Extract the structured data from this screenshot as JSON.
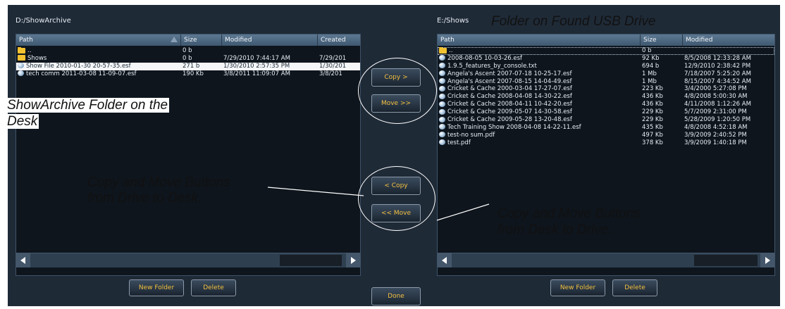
{
  "left_panel": {
    "title": "D:/ShowArchive",
    "columns": [
      "Path",
      "Size",
      "Modified",
      "Created"
    ],
    "rows": [
      {
        "icon": "folder-icon",
        "path": "..",
        "size": "0 b",
        "modified": "",
        "created": "",
        "selected": false
      },
      {
        "icon": "folder-icon",
        "path": "Shows",
        "size": "0 b",
        "modified": "7/29/2010 7:44:17 AM",
        "created": "7/29/201",
        "selected": false
      },
      {
        "icon": "show-file-icon",
        "path": "Show File 2010-01-30 20-57-35.esf",
        "size": "271 b",
        "modified": "1/30/2010 2:57:35 PM",
        "created": "1/30/201",
        "selected": true
      },
      {
        "icon": "show-file-icon",
        "path": "tech comm 2011-03-08 11-09-07.esf",
        "size": "190 Kb",
        "modified": "3/8/2011 11:09:07 AM",
        "created": "3/8/201",
        "selected": false
      }
    ],
    "buttons": {
      "new_folder": "New Folder",
      "delete": "Delete"
    }
  },
  "right_panel": {
    "title": "E:/Shows",
    "columns": [
      "Path",
      "Size",
      "Modified"
    ],
    "rows": [
      {
        "icon": "folder-icon",
        "path": "..",
        "size": "0 b",
        "modified": ""
      },
      {
        "icon": "show-file-icon",
        "path": "2008-08-05 10-03-26.esf",
        "size": "92 Kb",
        "modified": "8/5/2008 12:33:28 AM"
      },
      {
        "icon": "show-file-icon",
        "path": "1.9.5_features_by_console.txt",
        "size": "694 b",
        "modified": "12/9/2010 2:38:42 PM"
      },
      {
        "icon": "show-file-icon",
        "path": "Angela's Ascent 2007-07-18 10-25-17.esf",
        "size": "1 Mb",
        "modified": "7/18/2007 5:25:20 AM"
      },
      {
        "icon": "show-file-icon",
        "path": "Angela's Ascent 2007-08-15 14-04-49.esf",
        "size": "1 Mb",
        "modified": "8/15/2007 4:34:52 AM"
      },
      {
        "icon": "show-file-icon",
        "path": "Cricket & Cache 2000-03-04 17-27-07.esf",
        "size": "223 Kb",
        "modified": "3/4/2000 5:27:08 PM"
      },
      {
        "icon": "show-file-icon",
        "path": "Cricket & Cache 2008-04-08 14-30-22.esf",
        "size": "436 Kb",
        "modified": "4/8/2008 5:00:30 AM"
      },
      {
        "icon": "show-file-icon",
        "path": "Cricket & Cache 2008-04-11 10-42-20.esf",
        "size": "436 Kb",
        "modified": "4/11/2008 1:12:26 AM"
      },
      {
        "icon": "show-file-icon",
        "path": "Cricket & Cache 2009-05-07 14-30-58.esf",
        "size": "229 Kb",
        "modified": "5/7/2009 2:31:00 PM"
      },
      {
        "icon": "show-file-icon",
        "path": "Cricket & Cache 2009-05-28 13-20-48.esf",
        "size": "229 Kb",
        "modified": "5/28/2009 1:20:50 PM"
      },
      {
        "icon": "show-file-icon",
        "path": "Tech Training Show 2008-04-08 14-22-11.esf",
        "size": "435 Kb",
        "modified": "4/8/2008 4:52:18 AM"
      },
      {
        "icon": "show-file-icon",
        "path": "test-no sum.pdf",
        "size": "497 Kb",
        "modified": "3/9/2009 2:40:52 PM"
      },
      {
        "icon": "show-file-icon",
        "path": "test.pdf",
        "size": "378 Kb",
        "modified": "3/9/2009 1:40:18 PM"
      }
    ],
    "buttons": {
      "new_folder": "New Folder",
      "delete": "Delete"
    }
  },
  "center_buttons": {
    "copy_to_drive": "Copy >",
    "move_to_drive": "Move >>",
    "copy_to_desk": "< Copy",
    "move_to_desk": "<< Move",
    "done": "Done"
  },
  "annotations": {
    "usb_folder": "Folder on Found USB Drive",
    "desk_folder_line1": "ShowArchive Folder on the",
    "desk_folder_line2": "Desk",
    "drive_to_desk_line1": "Copy and Move Buttons",
    "drive_to_desk_line2": "from Drive to Desk.",
    "desk_to_drive_line1": "Copy and Move Buttons",
    "desk_to_drive_line2": "from Desk to Drive."
  },
  "colors": {
    "panel_bg": "#1f2a37",
    "button_text": "#f3c040",
    "selection": "#f4f6f8"
  }
}
